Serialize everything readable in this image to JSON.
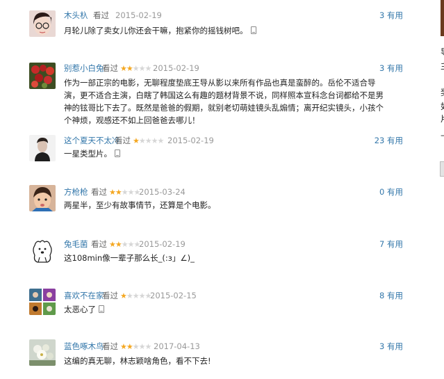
{
  "comments": [
    {
      "username": "木头杁",
      "watched": "看过",
      "rating": 0,
      "date": "2015-02-19",
      "useful_count": "3",
      "useful_label": "有用",
      "text": "月轮儿除了卖女儿你还会干嘛，抱紧你的摇钱树吧。",
      "has_phone_icon": true,
      "avatar": "girl-with-glasses"
    },
    {
      "username": "别惹小白兔",
      "watched": "看过",
      "rating": 2,
      "date": "2015-02-19",
      "useful_count": "3",
      "useful_label": "有用",
      "text": "作为一部正宗的电影，无聊程度垫底王导从影以来所有作品也真是蛮醉的。岳伦不适合导演，更不适合主演，白瞎了韩国这么有趣的题材背景不说，同样照本宣科念台词都给不是男神的铉哥比下去了。既然是爸爸的假期，就别老切萌娃镜头乱煽情；离开纪实镜头，小孩个个神烦，观感还不如上回爸爸去哪儿！",
      "has_phone_icon": false,
      "avatar": "red-berries"
    },
    {
      "username": "这个夏天不太冷",
      "watched": "看过",
      "rating": 1,
      "date": "2015-02-19",
      "useful_count": "23",
      "useful_label": "有用",
      "text": "一星类型片。",
      "has_phone_icon": true,
      "avatar": "man-portrait"
    },
    {
      "username": "方枪枪",
      "watched": "看过",
      "rating": 2,
      "date": "2015-03-24",
      "useful_count": "0",
      "useful_label": "有用",
      "text": "两星半，至少有故事情节，还算是个电影。",
      "has_phone_icon": false,
      "avatar": "child"
    },
    {
      "username": "兔毛菌",
      "watched": "看过",
      "rating": 2,
      "date": "2015-02-19",
      "useful_count": "7",
      "useful_label": "有用",
      "text": "这108min像一辈子那么长_(:з」∠)_",
      "has_phone_icon": false,
      "avatar": "bear-sketch"
    },
    {
      "username": "喜欢不在家",
      "watched": "看过",
      "rating": 1,
      "date": "2015-02-15",
      "useful_count": "8",
      "useful_label": "有用",
      "text": "太恶心了",
      "has_phone_icon": true,
      "avatar": "collage"
    },
    {
      "username": "蓝色啄木鸟",
      "watched": "看过",
      "rating": 2,
      "date": "2017-04-13",
      "useful_count": "3",
      "useful_label": "有用",
      "text": "这编的真无聊，林志颖啥角色，看不下去!",
      "has_phone_icon": false,
      "avatar": "flowers"
    }
  ],
  "sidebar_fragments": [
    "导",
    "主",
    "奖",
    "如",
    "片",
    "上"
  ],
  "colors": {
    "link": "#3377aa",
    "star_on": "#f4a720",
    "star_off": "#d6d6d6",
    "date": "#999999"
  }
}
